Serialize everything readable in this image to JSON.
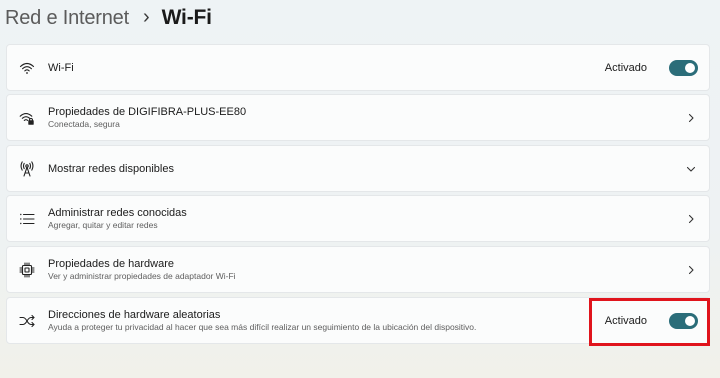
{
  "breadcrumb": {
    "parent": "Red e Internet",
    "separator": "›",
    "current": "Wi-Fi"
  },
  "settings": [
    {
      "title": "Wi-Fi",
      "subtitle": "",
      "icon": "wifi-icon",
      "control": "toggle",
      "state": "Activado",
      "on": true
    },
    {
      "title": "Propiedades de DIGIFIBRA-PLUS-EE80",
      "subtitle": "Conectada, segura",
      "icon": "wifi-secure-icon",
      "control": "chevron-right"
    },
    {
      "title": "Mostrar redes disponibles",
      "subtitle": "",
      "icon": "antenna-icon",
      "control": "chevron-down"
    },
    {
      "title": "Administrar redes conocidas",
      "subtitle": "Agregar, quitar y editar redes",
      "icon": "list-icon",
      "control": "chevron-right"
    },
    {
      "title": "Propiedades de hardware",
      "subtitle": "Ver y administrar propiedades de adaptador Wi-Fi",
      "icon": "chip-icon",
      "control": "chevron-right"
    },
    {
      "title": "Direcciones de hardware aleatorias",
      "subtitle": "Ayuda a proteger tu privacidad al hacer que sea más difícil realizar un seguimiento de la ubicación del dispositivo.",
      "icon": "shuffle-icon",
      "control": "toggle",
      "state": "Activado",
      "on": true
    }
  ],
  "colors": {
    "toggle_on": "#2b6d79",
    "highlight": "#e0141c"
  }
}
